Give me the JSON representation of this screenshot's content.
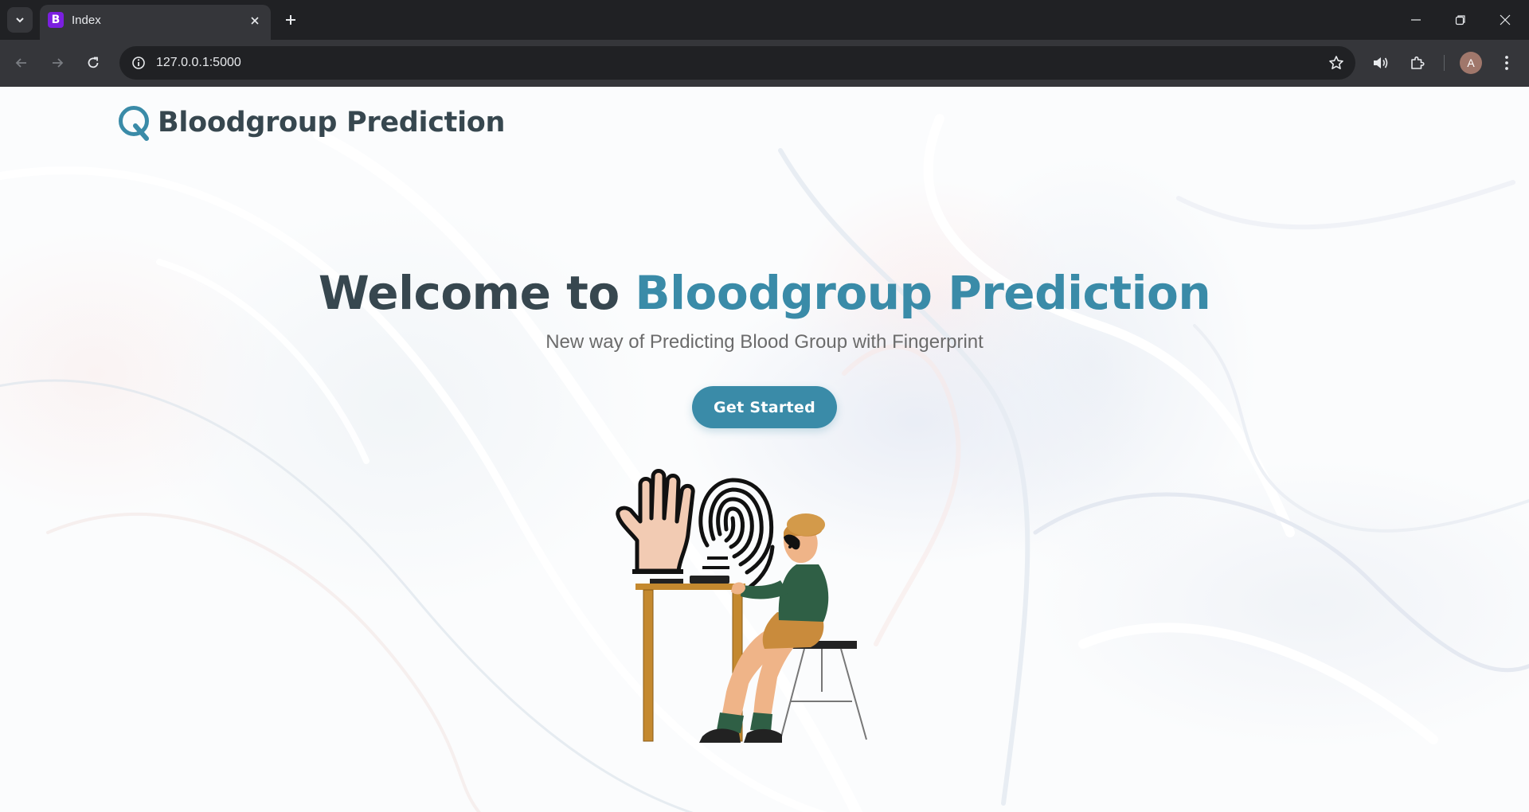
{
  "browser": {
    "tab": {
      "title": "Index",
      "favicon_letter": "B"
    },
    "url": "127.0.0.1:5000",
    "profile_initial": "A",
    "icons": {
      "tab_search": "chevron-down-icon",
      "tab_close": "close-icon",
      "new_tab": "plus-icon",
      "back": "arrow-left-icon",
      "forward": "arrow-right-icon",
      "reload": "reload-icon",
      "site_info": "info-icon",
      "bookmark": "star-icon",
      "media": "speaker-icon",
      "extensions": "puzzle-icon",
      "menu": "kebab-menu-icon",
      "minimize": "minimize-icon",
      "restore": "restore-icon",
      "close": "close-icon"
    }
  },
  "page": {
    "brand": {
      "title": "Bloodgroup Prediction",
      "logo_icon": "q-logo-icon"
    },
    "hero": {
      "title_prefix": "Welcome to",
      "title_accent": "Bloodgroup Prediction",
      "subtitle": "New way of Predicting Blood Group with Fingerprint",
      "cta_label": "Get Started"
    },
    "illustration": "person-scanning-fingerprint-illustration"
  },
  "colors": {
    "accent": "#3a8ba8",
    "heading": "#37474f",
    "subtitle": "#6b6b6b",
    "chrome_dark": "#202124",
    "chrome_toolbar": "#35363a"
  }
}
